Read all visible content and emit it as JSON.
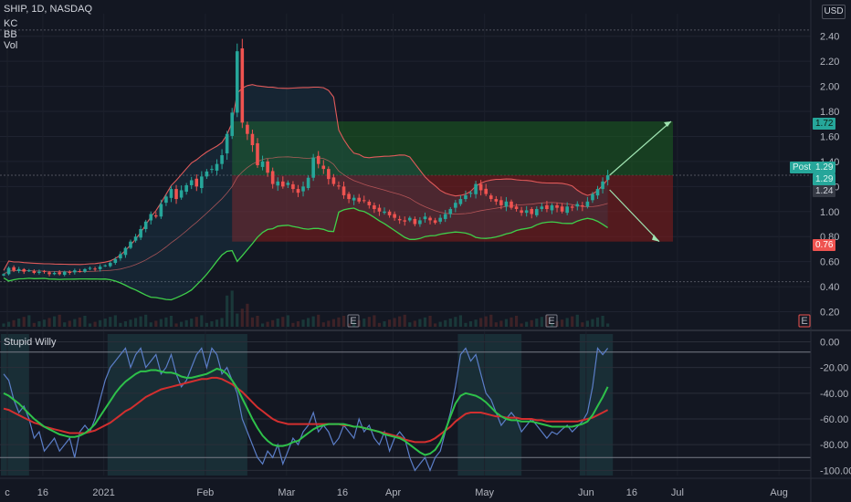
{
  "header": {
    "symbol": "SHIP, 1D, NASDAQ",
    "indicators": [
      "KC",
      "BB",
      "Vol"
    ],
    "currency": "USD",
    "oscillator_title": "Stupid Willy"
  },
  "colors": {
    "background": "#131722",
    "up": "#26a69a",
    "down": "#ef5350",
    "profit_zone": "#1b5e20",
    "loss_zone": "#7f1d1d",
    "bb_upper": "#e05a5a",
    "bb_lower": "#3fcf4a",
    "kc": "#e06666",
    "willy": "#5b7ec8",
    "sig_fast": "#2ec14a",
    "sig_slow": "#d32f2f",
    "position": "#26a69a"
  },
  "price_tags": [
    {
      "label": "1.72",
      "kind": "target",
      "color": "#26a69a",
      "text_color": "#0b1e12"
    },
    {
      "label": "Post",
      "kind": "label",
      "color": "#26a69a",
      "text_color": "#d9f5ef"
    },
    {
      "label": "1.29",
      "kind": "entry",
      "color": "#26a69a",
      "text_color": "#d9f5ef"
    },
    {
      "label": "1.29",
      "kind": "last",
      "color": "#26a69a",
      "text_color": "#d9f5ef"
    },
    {
      "label": "1.24",
      "kind": "price",
      "color": "#363a45",
      "text_color": "#d1d4dc"
    },
    {
      "label": "0.76",
      "kind": "stop",
      "color": "#ef5350",
      "text_color": "#ffffff"
    }
  ],
  "earnings_markers": [
    "E",
    "E",
    "E"
  ],
  "chart_data": [
    {
      "type": "candlestick",
      "title": "SHIP, 1D, NASDAQ",
      "y_axis_ticks": [
        "0.20",
        "0.40",
        "0.60",
        "0.80",
        "1.00",
        "1.20",
        "1.40",
        "1.60",
        "1.80",
        "2.00",
        "2.20",
        "2.40"
      ],
      "x_axis_ticks": [
        "c",
        "16",
        "2021",
        "Feb",
        "Mar",
        "16",
        "Apr",
        "May",
        "Jun",
        "16",
        "Jul",
        "Aug"
      ],
      "ylim": [
        0.08,
        2.58
      ],
      "close_series": [
        0.5,
        0.55,
        0.53,
        0.54,
        0.52,
        0.53,
        0.51,
        0.52,
        0.52,
        0.5,
        0.51,
        0.5,
        0.52,
        0.51,
        0.53,
        0.52,
        0.54,
        0.55,
        0.54,
        0.56,
        0.57,
        0.59,
        0.62,
        0.66,
        0.71,
        0.76,
        0.8,
        0.86,
        0.92,
        0.98,
        0.96,
        1.06,
        1.12,
        1.18,
        1.1,
        1.17,
        1.21,
        1.25,
        1.2,
        1.28,
        1.32,
        1.34,
        1.38,
        1.45,
        1.62,
        1.79,
        2.28,
        1.71,
        1.62,
        1.53,
        1.37,
        1.4,
        1.31,
        1.22,
        1.24,
        1.2,
        1.23,
        1.18,
        1.15,
        1.2,
        1.27,
        1.43,
        1.38,
        1.34,
        1.26,
        1.22,
        1.2,
        1.13,
        1.1,
        1.11,
        1.08,
        1.09,
        1.05,
        1.02,
        1.0,
        1.0,
        0.97,
        0.95,
        0.93,
        0.92,
        0.95,
        0.9,
        0.93,
        0.96,
        0.93,
        0.91,
        0.95,
        0.98,
        1.02,
        1.07,
        1.1,
        1.13,
        1.15,
        1.22,
        1.17,
        1.14,
        1.1,
        1.08,
        1.05,
        1.08,
        1.03,
        1.02,
        0.99,
        1.01,
        0.98,
        1.02,
        1.04,
        1.02,
        1.05,
        1.03,
        1.0,
        1.04,
        1.03,
        1.06,
        1.04,
        1.08,
        1.14,
        1.18,
        1.24,
        1.29
      ],
      "position": {
        "entry": 1.29,
        "target": 1.72,
        "stop": 0.76
      },
      "overlays": [
        "Keltner Channel",
        "Bollinger Bands",
        "Volume"
      ]
    },
    {
      "type": "line",
      "title": "Stupid Willy",
      "ylim": [
        -104,
        6
      ],
      "y_axis_ticks": [
        "0.00",
        "-20.00",
        "-40.00",
        "-60.00",
        "-80.00",
        "-100.00"
      ],
      "series": [
        {
          "values": [
            -25,
            -30,
            -45,
            -55,
            -50,
            -60,
            -75,
            -70,
            -85,
            -80,
            -75,
            -85,
            -80,
            -75,
            -90,
            -70,
            -65,
            -70,
            -60,
            -45,
            -30,
            -20,
            -15,
            -10,
            -5,
            -20,
            -10,
            -5,
            -20,
            -15,
            -10,
            -25,
            -20,
            -10,
            -25,
            -35,
            -30,
            -20,
            -10,
            -5,
            -20,
            -5,
            -10,
            -25,
            -20,
            -30,
            -40,
            -60,
            -70,
            -80,
            -90,
            -95,
            -85,
            -90,
            -80,
            -95,
            -85,
            -75,
            -80,
            -70,
            -65,
            -55,
            -70,
            -65,
            -70,
            -80,
            -75,
            -65,
            -70,
            -75,
            -60,
            -70,
            -65,
            -75,
            -80,
            -70,
            -85,
            -75,
            -70,
            -75,
            -90,
            -100,
            -95,
            -90,
            -100,
            -90,
            -85,
            -70,
            -55,
            -35,
            -10,
            -5,
            -15,
            -10,
            -25,
            -40,
            -45,
            -55,
            -65,
            -60,
            -55,
            -60,
            -70,
            -65,
            -60,
            -65,
            -70,
            -75,
            -70,
            -72,
            -68,
            -65,
            -70,
            -66,
            -62,
            -55,
            -35,
            -5,
            -10,
            -5
          ]
        },
        {
          "values": [
            -40,
            -42,
            -45,
            -48,
            -52,
            -56,
            -60,
            -63,
            -66,
            -68,
            -70,
            -72,
            -73,
            -74,
            -74,
            -73,
            -71,
            -68,
            -64,
            -58,
            -52,
            -46,
            -40,
            -35,
            -31,
            -28,
            -25,
            -23,
            -23,
            -22,
            -22,
            -23,
            -24,
            -24,
            -25,
            -27,
            -28,
            -28,
            -27,
            -26,
            -25,
            -23,
            -21,
            -22,
            -25,
            -30,
            -36,
            -44,
            -52,
            -60,
            -67,
            -73,
            -77,
            -80,
            -81,
            -81,
            -80,
            -78,
            -77,
            -74,
            -71,
            -68,
            -66,
            -65,
            -64,
            -64,
            -64,
            -64,
            -65,
            -66,
            -66,
            -67,
            -68,
            -69,
            -70,
            -72,
            -73,
            -74,
            -75,
            -77,
            -80,
            -83,
            -86,
            -88,
            -87,
            -84,
            -78,
            -69,
            -58,
            -48,
            -42,
            -40,
            -41,
            -42,
            -44,
            -47,
            -51,
            -55,
            -58,
            -60,
            -61,
            -61,
            -62,
            -62,
            -62,
            -63,
            -64,
            -65,
            -66,
            -66,
            -66,
            -66,
            -66,
            -65,
            -64,
            -62,
            -57,
            -50,
            -43,
            -35
          ]
        },
        {
          "values": [
            -52,
            -53,
            -55,
            -57,
            -59,
            -61,
            -63,
            -64,
            -66,
            -67,
            -68,
            -69,
            -70,
            -71,
            -71,
            -71,
            -71,
            -70,
            -69,
            -67,
            -65,
            -63,
            -60,
            -57,
            -54,
            -52,
            -49,
            -46,
            -43,
            -41,
            -39,
            -37,
            -36,
            -35,
            -34,
            -33,
            -32,
            -31,
            -30,
            -29,
            -29,
            -28,
            -28,
            -29,
            -31,
            -33,
            -36,
            -39,
            -43,
            -47,
            -51,
            -54,
            -57,
            -60,
            -62,
            -63,
            -64,
            -64,
            -64,
            -64,
            -64,
            -64,
            -64,
            -64,
            -64,
            -64,
            -64,
            -65,
            -65,
            -66,
            -66,
            -67,
            -68,
            -69,
            -70,
            -71,
            -72,
            -73,
            -74,
            -76,
            -77,
            -78,
            -78,
            -78,
            -77,
            -75,
            -72,
            -69,
            -66,
            -62,
            -59,
            -56,
            -55,
            -55,
            -55,
            -56,
            -57,
            -58,
            -58,
            -59,
            -59,
            -59,
            -60,
            -60,
            -60,
            -61,
            -61,
            -62,
            -62,
            -62,
            -62,
            -62,
            -62,
            -62,
            -61,
            -60,
            -59,
            -57,
            -55,
            -53
          ]
        }
      ]
    }
  ]
}
